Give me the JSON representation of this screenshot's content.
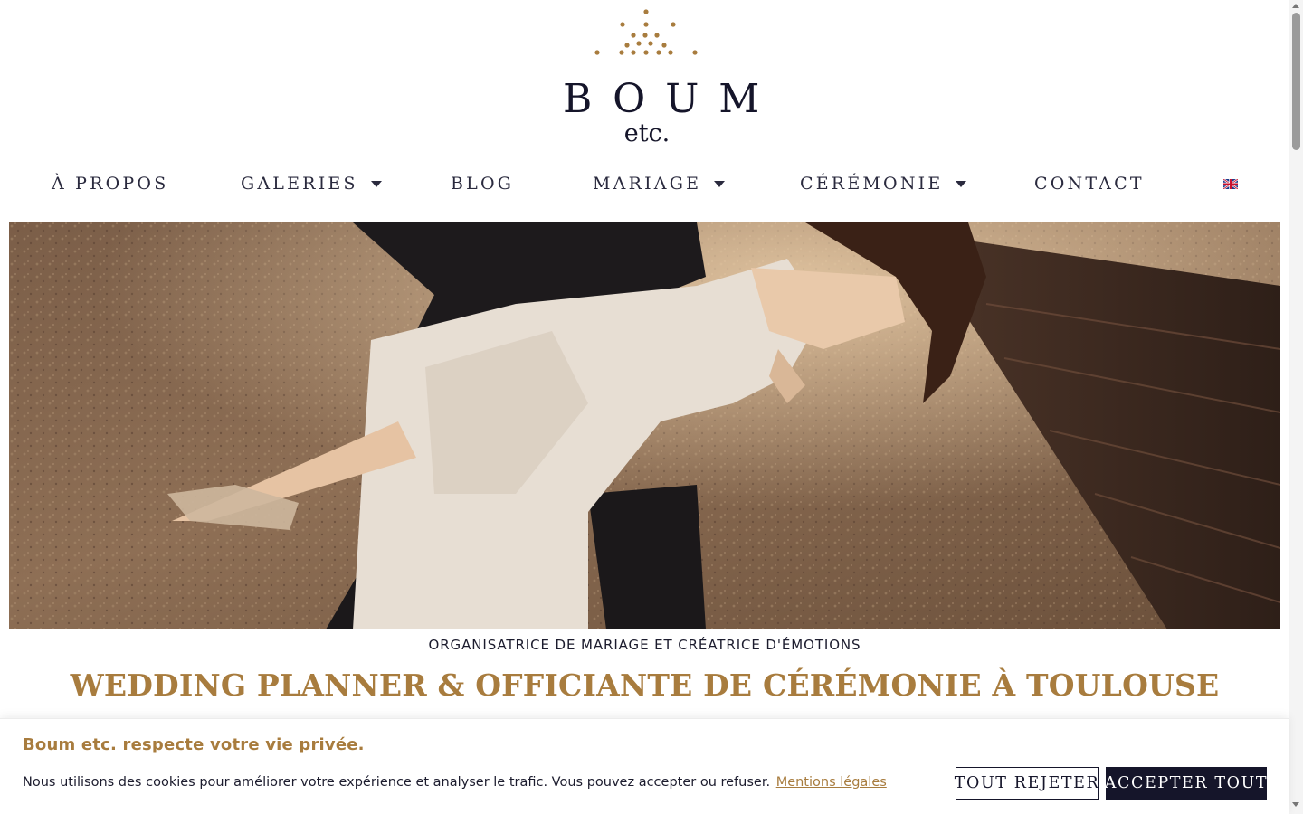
{
  "brand": {
    "name": "BOUM",
    "suffix": "etc.",
    "accent": "#a87c3e",
    "ink": "#15152a"
  },
  "nav": {
    "items": [
      {
        "label": "À PROPOS"
      },
      {
        "label": "GALERIES"
      },
      {
        "label": "BLOG"
      },
      {
        "label": "MARIAGE"
      },
      {
        "label": "CÉRÉMONIE"
      },
      {
        "label": "CONTACT"
      }
    ],
    "language_flag": "uk-flag-icon"
  },
  "hero": {
    "image": "wedding-couple-photo"
  },
  "intro": {
    "tagline": "ORGANISATRICE DE MARIAGE ET CRÉATRICE D'ÉMOTIONS",
    "headline": "WEDDING PLANNER & OFFICIANTE DE CÉRÉMONIE À TOULOUSE"
  },
  "cookie": {
    "title": "Boum etc. respecte votre vie privée.",
    "text": "Nous utilisons des cookies pour améliorer votre expérience et analyser le trafic. Vous pouvez accepter ou refuser.",
    "link": "Mentions légales",
    "reject_label": "TOUT REJETER",
    "accept_label": "ACCEPTER TOUT"
  }
}
